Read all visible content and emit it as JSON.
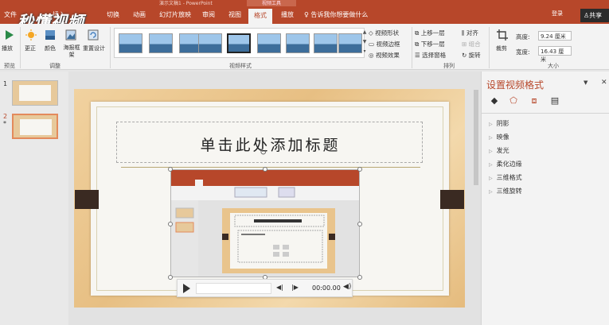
{
  "window": {
    "title": "演示文稿1 - PowerPoint",
    "context_tab": "视频工具"
  },
  "tabs": [
    "文件",
    "插入",
    "切换",
    "动画",
    "幻灯片放映",
    "审阅",
    "视图",
    "格式",
    "播放"
  ],
  "active_tab": "格式",
  "tell_me": "告诉我你想要做什么",
  "account": "登录",
  "share": "共享",
  "watermark": "秒懂视频",
  "ribbon": {
    "preview": {
      "play": "播放",
      "group": "预览"
    },
    "adjust": {
      "correct": "更正",
      "color": "颜色",
      "poster": "海报框架",
      "reset": "重置设计",
      "group": "调整"
    },
    "styles": {
      "group": "视频样式",
      "shape": "视频形状",
      "border": "视频边框",
      "effects": "视频效果"
    },
    "arrange": {
      "bring_forward": "上移一层",
      "send_backward": "下移一层",
      "selection_pane": "选择窗格",
      "align": "对齐",
      "group_objs": "组合",
      "rotate": "旋转",
      "group": "排列"
    },
    "size": {
      "crop": "裁剪",
      "height_label": "高度:",
      "height": "9.24 厘米",
      "width_label": "宽度:",
      "width": "16.43 厘米",
      "group": "大小"
    }
  },
  "slides": [
    {
      "num": "1"
    },
    {
      "num": "2",
      "star": "*"
    }
  ],
  "slide": {
    "title_placeholder": "单击此处添加标题"
  },
  "video_controls": {
    "time": "00:00.00"
  },
  "format_pane": {
    "title": "设置视频格式",
    "sections": [
      "阴影",
      "映像",
      "发光",
      "柔化边缘",
      "三维格式",
      "三维旋转"
    ]
  }
}
